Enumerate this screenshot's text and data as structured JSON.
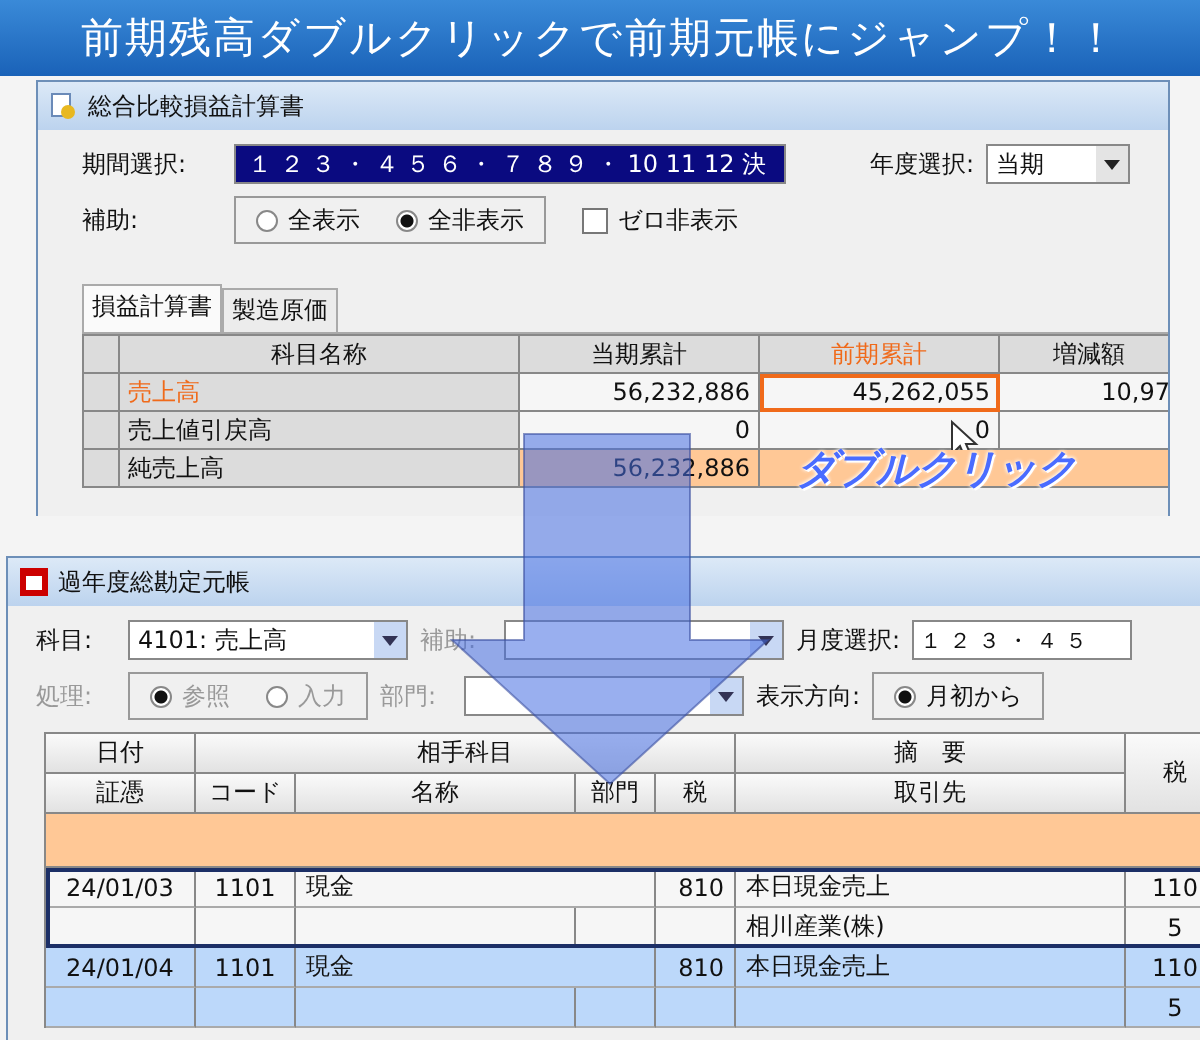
{
  "banner": {
    "title": "前期残高ダブルクリックで前期元帳にジャンプ！！"
  },
  "report_window": {
    "title": "総合比較損益計算書",
    "period": {
      "label": "期間選択:",
      "value": "１ ２ ３ ・ ４ ５ ６ ・ ７ ８ ９ ・ 10 11 12 決"
    },
    "year": {
      "label": "年度選択:",
      "value": "当期"
    },
    "aux": {
      "label": "補助:",
      "options": [
        {
          "label": "全表示",
          "selected": false
        },
        {
          "label": "全非表示",
          "selected": true
        }
      ]
    },
    "zero_hide": {
      "label": "ゼロ非表示",
      "checked": false
    },
    "tabs": [
      {
        "label": "損益計算書",
        "selected": true
      },
      {
        "label": "製造原価",
        "selected": false
      }
    ],
    "table": {
      "columns": [
        "科目名称",
        "当期累計",
        "前期累計",
        "増減額"
      ],
      "rows": [
        {
          "kind": "selected",
          "name": "売上高",
          "current": "56,232,886",
          "previous": "45,262,055",
          "diff": "10,97"
        },
        {
          "kind": "normal",
          "name": "売上値引戻高",
          "current": "0",
          "previous": "0"
        },
        {
          "kind": "total",
          "name": "純売上高",
          "current": "56,232,886"
        }
      ]
    }
  },
  "callout": {
    "text": "ダブルクリック"
  },
  "ledger_window": {
    "title": "過年度総勘定元帳",
    "account": {
      "label": "科目:",
      "value": "4101: 売上高"
    },
    "sub": {
      "label": "補助:"
    },
    "month": {
      "label": "月度選択:",
      "value": "１ ２ ３ ・ ４ ５"
    },
    "process": {
      "label": "処理:",
      "disabled": true,
      "options": [
        {
          "label": "参照",
          "selected": true
        },
        {
          "label": "入力",
          "selected": false
        }
      ]
    },
    "dept": {
      "label": "部門:"
    },
    "direction": {
      "label": "表示方向:",
      "options": [
        {
          "label": "月初から",
          "selected": true
        }
      ]
    },
    "table": {
      "header_top": [
        "日付",
        "相手科目",
        "摘　要",
        "税"
      ],
      "header_bottom": [
        "証憑",
        "コード",
        "名称",
        "部門",
        "税",
        "取引先"
      ],
      "entries": [
        {
          "selected": true,
          "shaded": false,
          "date": "24/01/03",
          "code": "1101",
          "name": "現金",
          "tax": "810",
          "summary": "本日現金売上",
          "amount": "110",
          "partner": "相川産業(株)",
          "sub_amount": "5"
        },
        {
          "selected": false,
          "shaded": true,
          "date": "24/01/04",
          "code": "1101",
          "name": "現金",
          "tax": "810",
          "summary": "本日現金売上",
          "amount": "110",
          "sub_amount": "5"
        }
      ]
    }
  }
}
